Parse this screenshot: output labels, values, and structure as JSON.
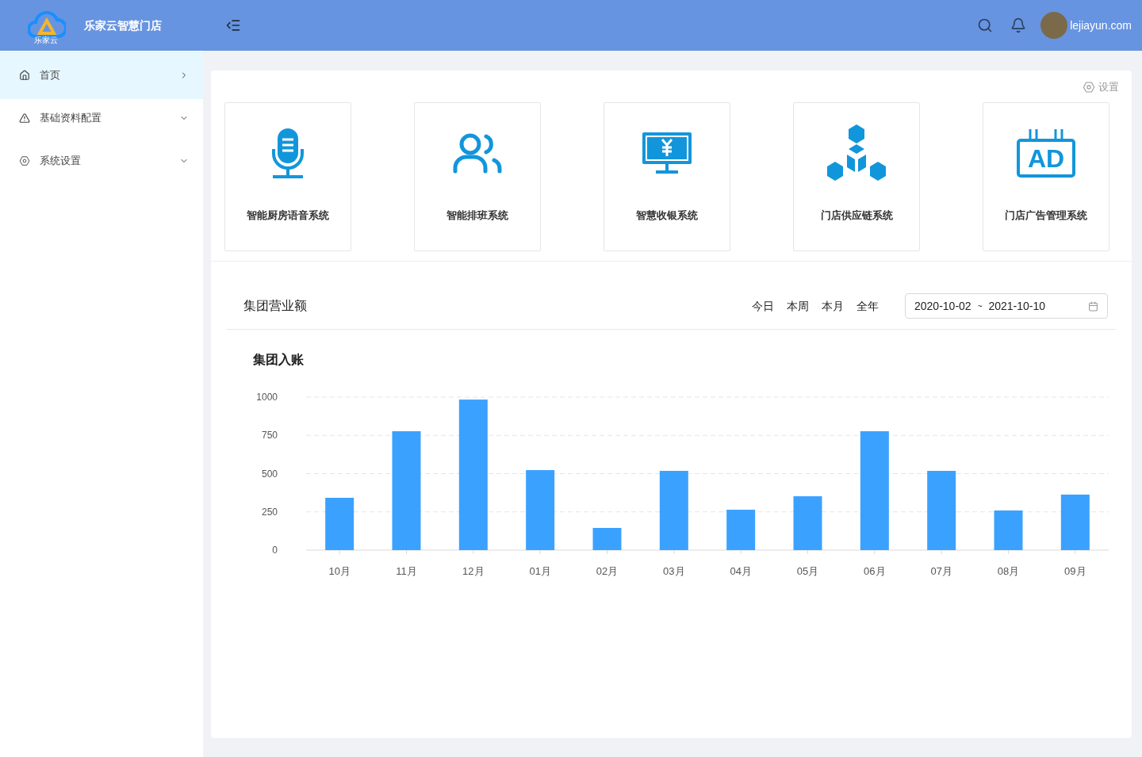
{
  "header": {
    "logo_caption": "乐家云",
    "title": "乐家云智慧门店",
    "username": "lejiayun.com"
  },
  "sidebar": {
    "items": [
      {
        "label": "首页",
        "kind": "link",
        "selected": true
      },
      {
        "label": "基础资料配置",
        "kind": "submenu",
        "selected": false
      },
      {
        "label": "系统设置",
        "kind": "submenu",
        "selected": false
      }
    ]
  },
  "settings_link": "设置",
  "systems": [
    {
      "label": "智能厨房语音系统"
    },
    {
      "label": "智能排班系统"
    },
    {
      "label": "智慧收银系统"
    },
    {
      "label": "门店供应链系统"
    },
    {
      "label": "门店广告管理系统",
      "icon_text": "AD"
    }
  ],
  "revenue": {
    "title": "集团营业额",
    "ranges": [
      "今日",
      "本周",
      "本月",
      "全年"
    ],
    "date_start": "2020-10-02",
    "date_sep": "~",
    "date_end": "2021-10-10",
    "chart_data": {
      "type": "bar",
      "title": "集团入账",
      "grid": true,
      "categories": [
        "10月",
        "11月",
        "12月",
        "01月",
        "02月",
        "03月",
        "04月",
        "05月",
        "06月",
        "07月",
        "08月",
        "09月"
      ],
      "series": [
        {
          "color": "#3ba1ff",
          "values": [
            342,
            777,
            984,
            523,
            145,
            518,
            264,
            352,
            777,
            518,
            259,
            363
          ]
        }
      ],
      "ylim": [
        0,
        1000
      ],
      "yticks": [
        0,
        250,
        500,
        750,
        1000
      ]
    }
  }
}
